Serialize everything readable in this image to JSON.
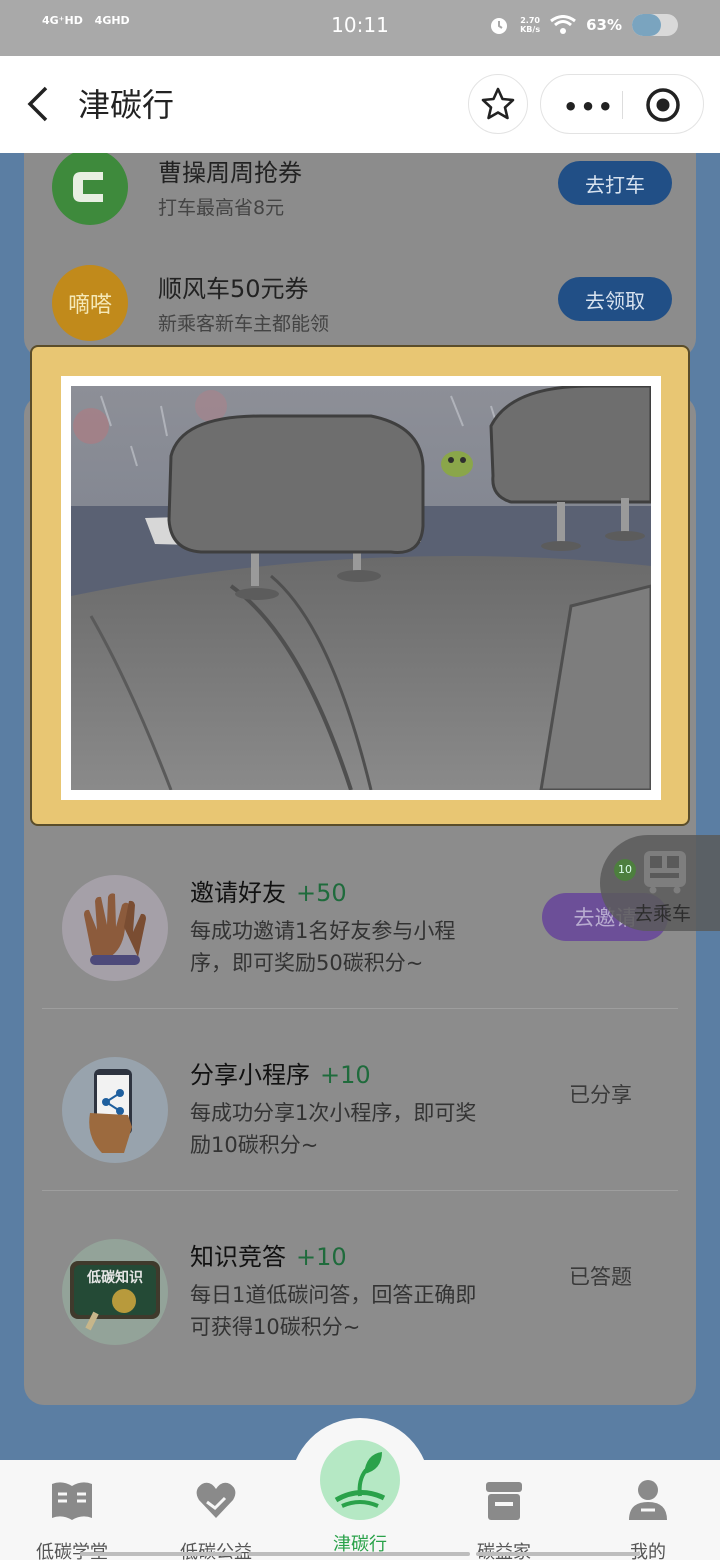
{
  "status_bar": {
    "signal1": "4G⁺HD",
    "signal2": "4GHD",
    "time": "10:11",
    "net_speed_value": "2.70",
    "net_speed_unit": "KB/s",
    "battery_text": "63%",
    "battery_level": 0.63
  },
  "header": {
    "title": "津碳行"
  },
  "coupons": [
    {
      "name": "曹操周周抢券",
      "desc": "打车最高省8元",
      "button": "去打车",
      "logo_text": "C",
      "logo_color": "#3e8a3c"
    },
    {
      "name": "顺风车50元券",
      "desc": "新乘客新车主都能领",
      "button": "去领取",
      "logo_text": "嘀嗒",
      "logo_color": "#c18a1b"
    }
  ],
  "tasks": [
    {
      "name": "邀请好友",
      "points": "+50",
      "desc": "每成功邀请1名好友参与小程序，即可奖励50碳积分~",
      "action": "去邀请",
      "action_type": "button"
    },
    {
      "name": "分享小程序",
      "points": "+10",
      "desc": "每成功分享1次小程序，即可奖励10碳积分~",
      "action": "已分享",
      "action_type": "done"
    },
    {
      "name": "知识竞答",
      "points": "+10",
      "desc": "每日1道低碳问答，回答正确即可获得10碳积分~",
      "action": "已答题",
      "action_type": "done",
      "icon_text": "低碳知识"
    }
  ],
  "floating_bus": {
    "label": "去乘车",
    "badge": "10"
  },
  "tabbar": [
    {
      "label": "低碳学堂",
      "icon": "book-icon"
    },
    {
      "label": "低碳公益",
      "icon": "heart-hand-icon"
    },
    {
      "label": "津碳行",
      "icon": "sprout-icon",
      "active": true
    },
    {
      "label": "碳益家",
      "icon": "shop-icon"
    },
    {
      "label": "我的",
      "icon": "user-icon"
    }
  ],
  "colors": {
    "accent_green": "#2aa24a",
    "button_blue": "#214f86",
    "popup_frame": "#e8c673"
  }
}
